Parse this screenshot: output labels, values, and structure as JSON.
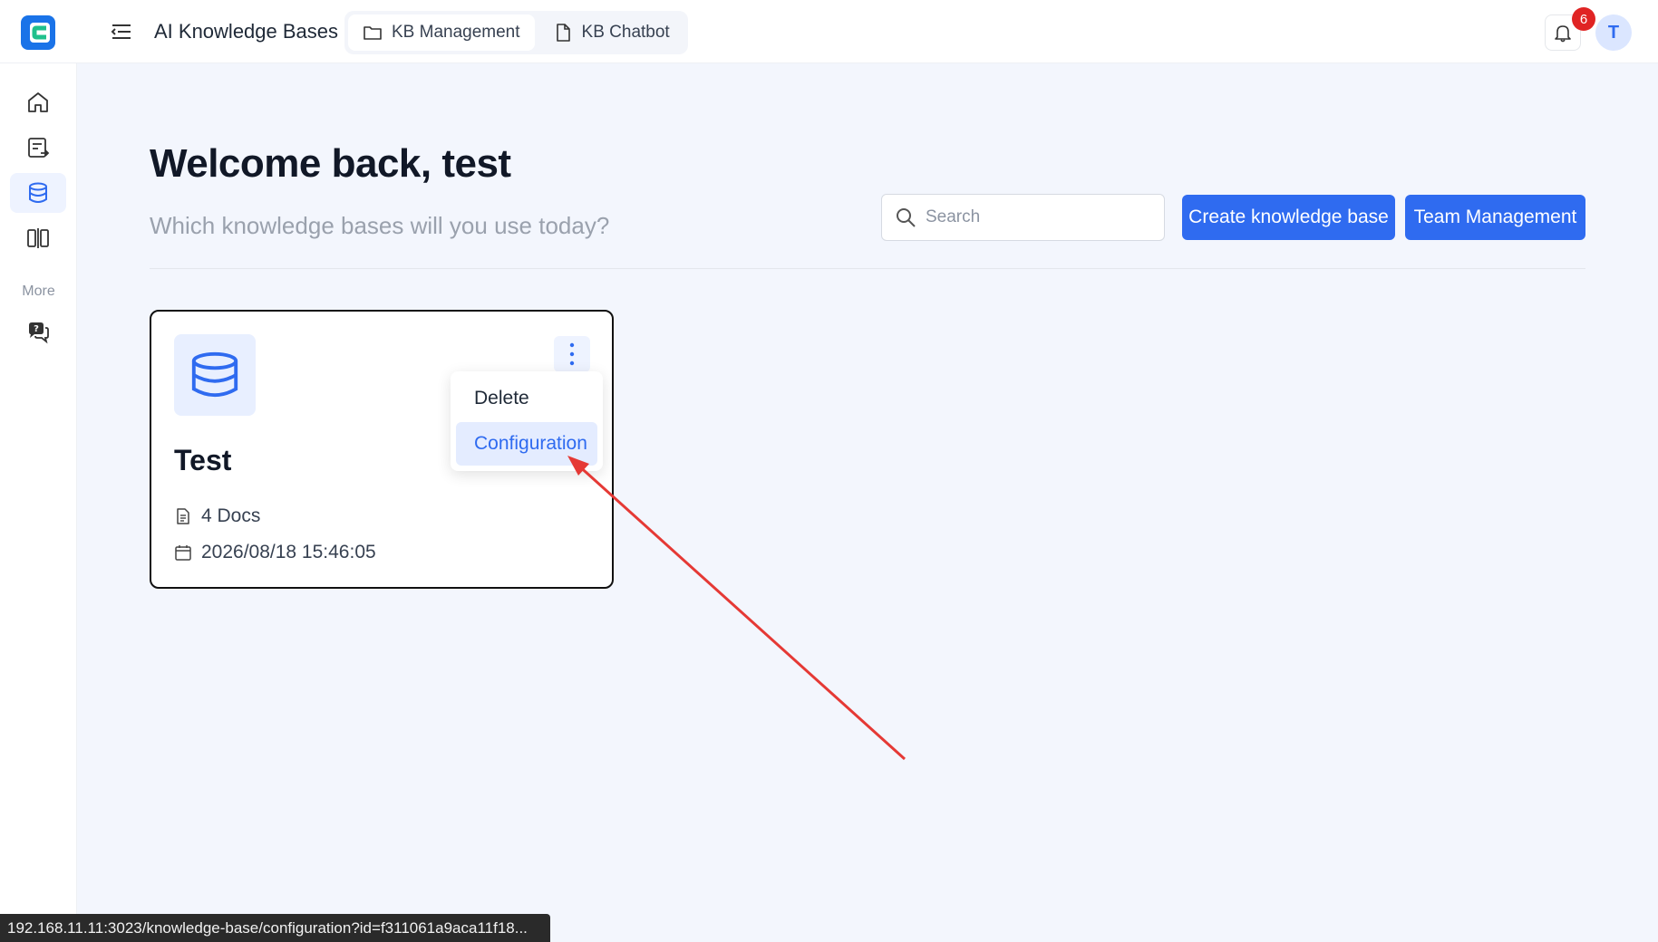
{
  "header": {
    "app_title": "AI Knowledge Bases",
    "tabs": [
      {
        "label": "KB Management",
        "icon": "folder-icon",
        "active": true
      },
      {
        "label": "KB Chatbot",
        "icon": "document-icon",
        "active": false
      }
    ],
    "notification_count": "6",
    "avatar_initial": "T"
  },
  "sidebar": {
    "items": [
      {
        "name": "home",
        "icon": "home-icon",
        "active": false
      },
      {
        "name": "documents",
        "icon": "document-export-icon",
        "active": false
      },
      {
        "name": "knowledge-base",
        "icon": "database-icon",
        "active": true
      },
      {
        "name": "compare",
        "icon": "compare-columns-icon",
        "active": false
      }
    ],
    "more_label": "More",
    "more_items": [
      {
        "name": "chat-help",
        "icon": "chat-question-icon"
      }
    ]
  },
  "main": {
    "welcome": "Welcome back, test",
    "subtitle": "Which knowledge bases will you use today?",
    "search_placeholder": "Search",
    "create_button": "Create knowledge base",
    "team_button": "Team Management"
  },
  "knowledge_bases": [
    {
      "name": "Test",
      "docs": "4 Docs",
      "date": "2026/08/18 15:46:05"
    }
  ],
  "dropdown": {
    "items": [
      "Delete",
      "Configuration"
    ]
  },
  "status_bar_url": "192.168.11.11:3023/knowledge-base/configuration?id=f311061a9aca11f18...",
  "colors": {
    "primary": "#2f6bf0",
    "background": "#f3f6fd",
    "badge": "#e02424",
    "annotation_arrow": "#e53935"
  }
}
